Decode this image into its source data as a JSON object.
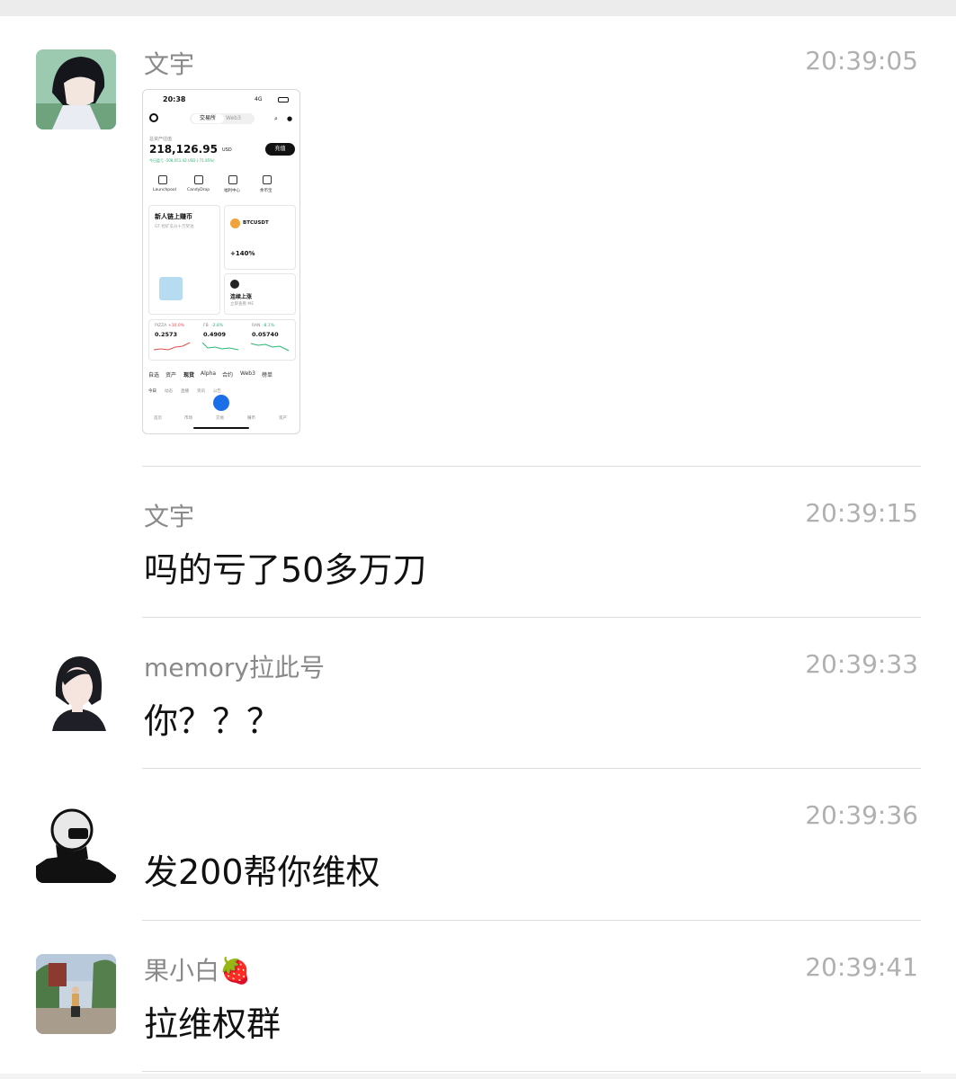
{
  "messages": [
    {
      "sender": "文宇",
      "time": "20:39:05",
      "type": "image",
      "image": {
        "status_time": "20:38",
        "status_signal": "4G",
        "tabs": [
          "交易所",
          "Web3"
        ],
        "balance_label": "总资产估值",
        "balance": "218,126.95",
        "balance_unit": "USD",
        "pnl": "今日盈亏 -508,051.42 USD (-71.85%)",
        "deposit_button": "充值",
        "quick_links": [
          "Launchpool",
          "CandyDrop",
          "福利中心",
          "余币宝"
        ],
        "promo_title": "新人链上赚币",
        "promo_subtitle": "GT 挖矿瓜分十万奖池",
        "btc_pair": "BTCUSDT",
        "btc_pct": "+140%",
        "streak_title": "连续上涨",
        "streak_subtitle": "立即查看 ME",
        "markets": [
          {
            "symbol": "PIZZA",
            "change": "+10.0%",
            "price": "0.2573"
          },
          {
            "symbol": "FB",
            "change": "-2.8%",
            "price": "0.4909"
          },
          {
            "symbol": "RAN",
            "change": "-8.1%",
            "price": "0.05740"
          }
        ],
        "bottom_tabs": [
          "自选",
          "资产",
          "现货",
          "Alpha",
          "合约",
          "Web3",
          "榜单"
        ],
        "sub_tabs": [
          "今日",
          "动态",
          "直播",
          "资讯",
          "公告"
        ],
        "nav": [
          "首页",
          "市场",
          "交易",
          "赚币",
          "资产"
        ]
      }
    },
    {
      "sender": "文宇",
      "time": "20:39:15",
      "type": "text",
      "text": "吗的亏了50多万刀"
    },
    {
      "sender": "memory拉此号",
      "time": "20:39:33",
      "type": "text",
      "text": "你？？？"
    },
    {
      "sender": "",
      "time": "20:39:36",
      "type": "text",
      "text": "发200帮你维权"
    },
    {
      "sender": "果小白🍓",
      "time": "20:39:41",
      "type": "text",
      "text": "拉维权群"
    }
  ],
  "colors": {
    "name": "#8a8a8a",
    "time": "#b0b0b0",
    "divider": "#dedede",
    "accent_blue": "#1a6fe8",
    "gain": "#2bb673",
    "loss": "#e24d4d"
  }
}
